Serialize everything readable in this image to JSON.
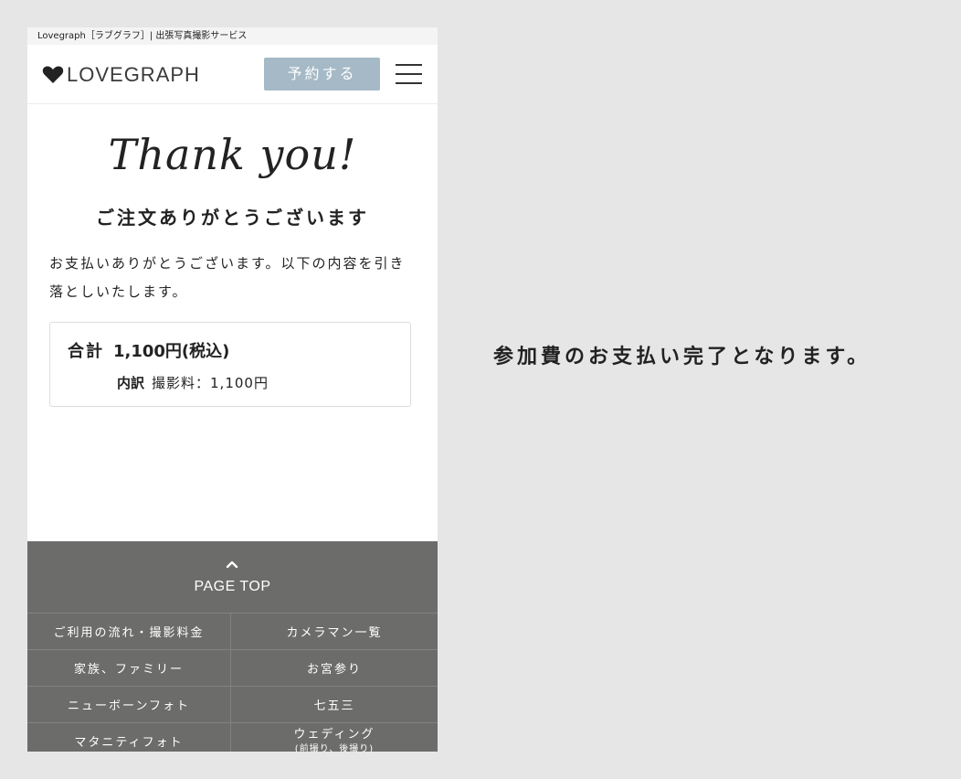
{
  "browser": {
    "site_title": "Lovegraph［ラブグラフ］| 出張写真撮影サービス"
  },
  "header": {
    "logo_text": "LOVEGRAPH",
    "logo_icon": "heart-icon",
    "reserve_label": "予約する",
    "menu_icon": "hamburger-menu-icon"
  },
  "main": {
    "thanks": "Thank you!",
    "heading": "ご注文ありがとうございます",
    "message": "お支払いありがとうございます。以下の内容を引き落としいたします。",
    "total": {
      "label": "合計",
      "amount": "1,100円(税込)",
      "breakdown_label": "内訳",
      "breakdown_value": "撮影料：1,100円"
    }
  },
  "footer": {
    "page_top": "PAGE TOP",
    "page_top_icon": "chevron-up-icon",
    "links": [
      {
        "left": "ご利用の流れ・撮影料金",
        "right": "カメラマン一覧"
      },
      {
        "left": "家族、ファミリー",
        "right": "お宮参り"
      },
      {
        "left": "ニューボーンフォト",
        "right": "七五三"
      },
      {
        "left": "マタニティフォト",
        "right": "ウェディング",
        "right_sub": "(前撮り、後撮り)"
      }
    ]
  },
  "caption": "参加費のお支払い完了となります。",
  "colors": {
    "background": "#e6e6e6",
    "button": "#a6b9c6",
    "footer": "#6c6c6a"
  }
}
